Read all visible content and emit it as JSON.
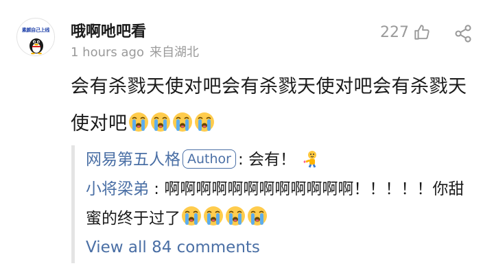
{
  "comment": {
    "avatar_caption": "素颜自己上线",
    "username": "哦啊吔吧看",
    "time": "1 hours ago",
    "location": "来自湖北",
    "likes": "227",
    "text": "会有杀戮天使对吧会有杀戮天使对吧会有杀戮天使对吧",
    "text_emojis": [
      "crying-face",
      "crying-face",
      "crying-face",
      "crying-face"
    ]
  },
  "replies": [
    {
      "name": "网易第五人格",
      "badge": "Author",
      "separator": ": ",
      "text": "会有！",
      "emoji": "flexing-cheer-emoji"
    },
    {
      "name": "小将梁弟",
      "separator": " : ",
      "text": "啊啊啊啊啊啊啊啊啊啊啊啊！！！！！你甜蜜的终于过了",
      "emojis": [
        "crying-face",
        "crying-face",
        "crying-face",
        "crying-face"
      ]
    }
  ],
  "view_all": "View all 84 comments",
  "icons": {
    "like": "thumbs-up-icon",
    "share": "share-icon",
    "avatar": "penguin-avatar"
  },
  "colors": {
    "link_blue": "#4a6fa5",
    "meta_gray": "#9a9a9a",
    "text": "#1a1a1a",
    "reply_border": "#e4e4e4"
  }
}
